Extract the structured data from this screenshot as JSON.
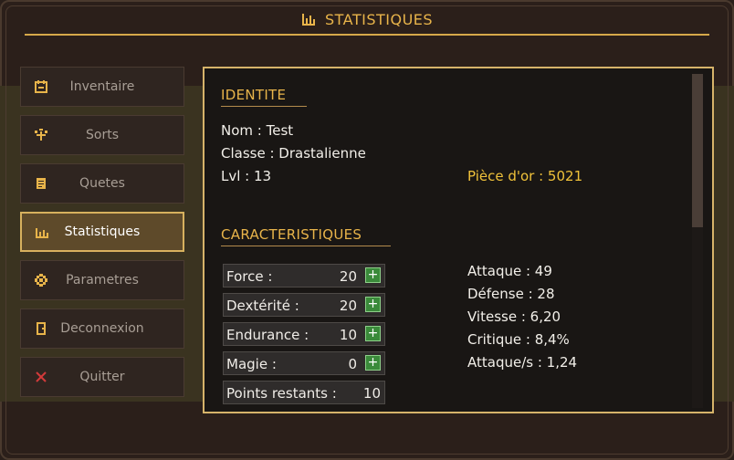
{
  "header": {
    "title": "STATISTIQUES",
    "icon": "bar-chart-icon"
  },
  "menu": {
    "items": [
      {
        "label": "Inventaire",
        "icon": "calendar-icon",
        "active": false
      },
      {
        "label": "Sorts",
        "icon": "sparkle-icon",
        "active": false
      },
      {
        "label": "Quetes",
        "icon": "scroll-icon",
        "active": false
      },
      {
        "label": "Statistiques",
        "icon": "bar-chart-icon",
        "active": true
      },
      {
        "label": "Parametres",
        "icon": "gear-icon",
        "active": false
      },
      {
        "label": "Deconnexion",
        "icon": "door-icon",
        "active": false
      },
      {
        "label": "Quitter",
        "icon": "close-icon",
        "active": false
      }
    ]
  },
  "identite": {
    "title": "IDENTITE",
    "name": "Nom : Test",
    "class": "Classe : Drastalienne",
    "level": "Lvl : 13",
    "gold": "Pièce d'or : 5021"
  },
  "caracteristiques": {
    "title": "CARACTERISTIQUES",
    "stats": [
      {
        "label": "Force :",
        "value": "20",
        "plus": "+"
      },
      {
        "label": "Dextérité :",
        "value": "20",
        "plus": "+"
      },
      {
        "label": "Endurance :",
        "value": "10",
        "plus": "+"
      },
      {
        "label": "Magie :",
        "value": "0",
        "plus": "+"
      }
    ],
    "remaining": {
      "label": "Points restants :",
      "value": "10"
    },
    "derived": [
      "Attaque : 49",
      "Défense : 28",
      "Vitesse : 6,20",
      "Critique : 8,4%",
      "Attaque/s : 1,24"
    ]
  },
  "colors": {
    "accent": "#e8b44a",
    "gold_text": "#f0c23a",
    "active_menu_bg": "#5e4a2a",
    "plus_button": "#3a8a3a"
  },
  "scroll": {
    "position_fraction": 0.0
  }
}
